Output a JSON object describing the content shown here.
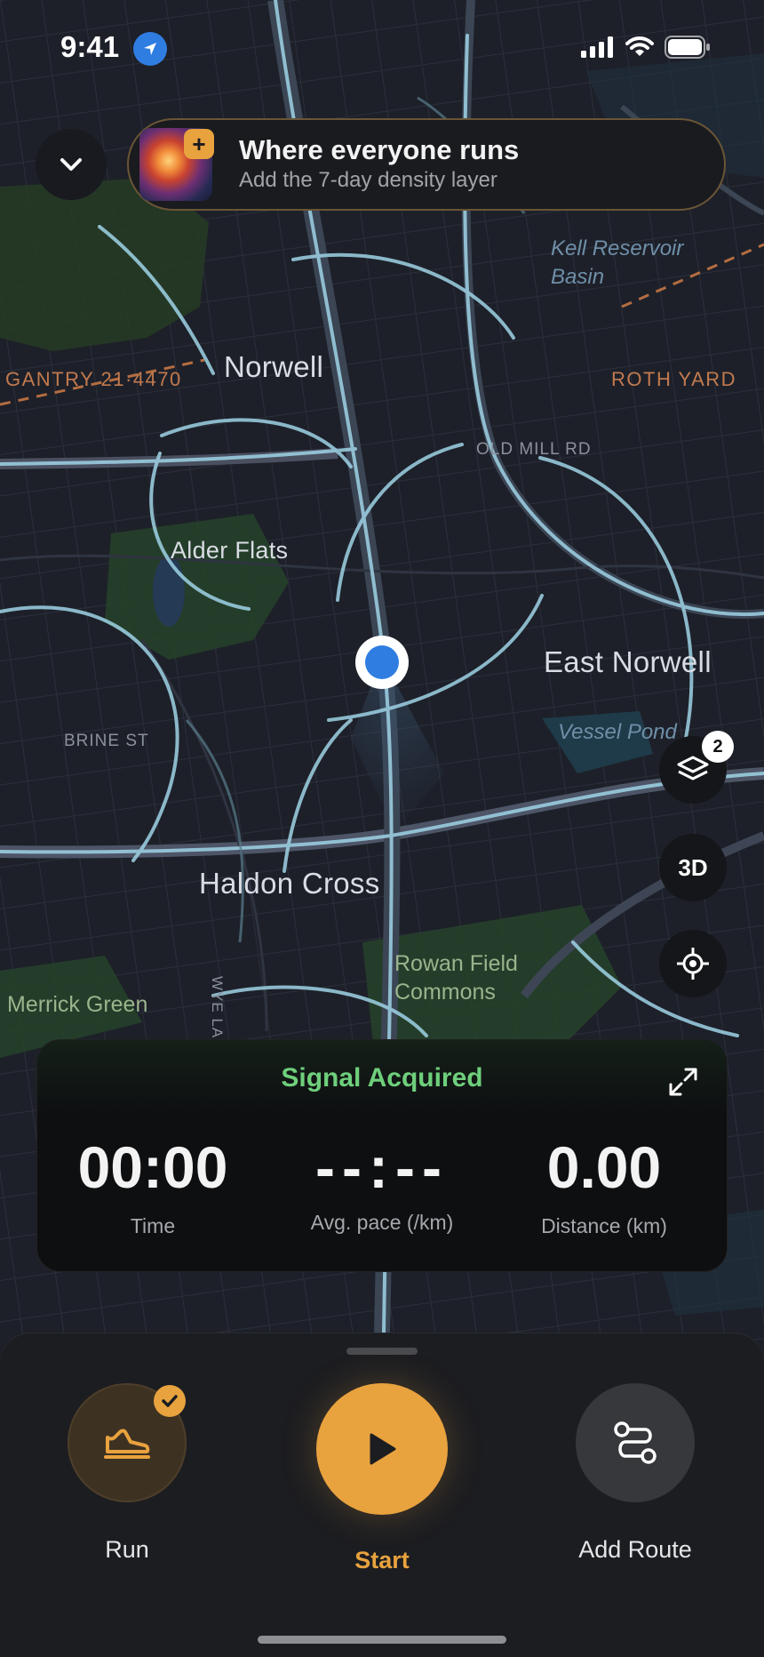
{
  "status_bar": {
    "time": "9:41"
  },
  "promo": {
    "title": "Where everyone runs",
    "subtitle": "Add the 7-day density layer"
  },
  "map_labels": {
    "gantry": "GANTRY 21·4470",
    "norwell": "Norwell",
    "kell": "Kell Reservoir",
    "basin": "Basin",
    "roth": "ROTH YARD",
    "old_mill": "OLD MILL RD",
    "alder": "Alder Flats",
    "east_norwell": "East Norwell",
    "vessel": "Vessel Pond",
    "brine": "BRINE ST",
    "haldon": "Haldon Cross",
    "wye": "WYE LANE",
    "rowan1": "Rowan Field",
    "rowan2": "Commons",
    "merrick": "Merrick Green"
  },
  "map_controls": {
    "layers_count": "2",
    "three_d_label": "3D"
  },
  "stats": {
    "signal": "Signal Acquired",
    "time_value": "00:00",
    "time_label": "Time",
    "pace_value": "--:--",
    "pace_label": "Avg. pace (/km)",
    "distance_value": "0.00",
    "distance_label": "Distance (km)"
  },
  "bottom": {
    "run_label": "Run",
    "start_label": "Start",
    "route_label": "Add Route"
  },
  "colors": {
    "accent": "#E8A23E",
    "signal_green": "#6FCF7C",
    "route_blue": "#9FD3E6",
    "location_blue": "#2F7DE1"
  }
}
